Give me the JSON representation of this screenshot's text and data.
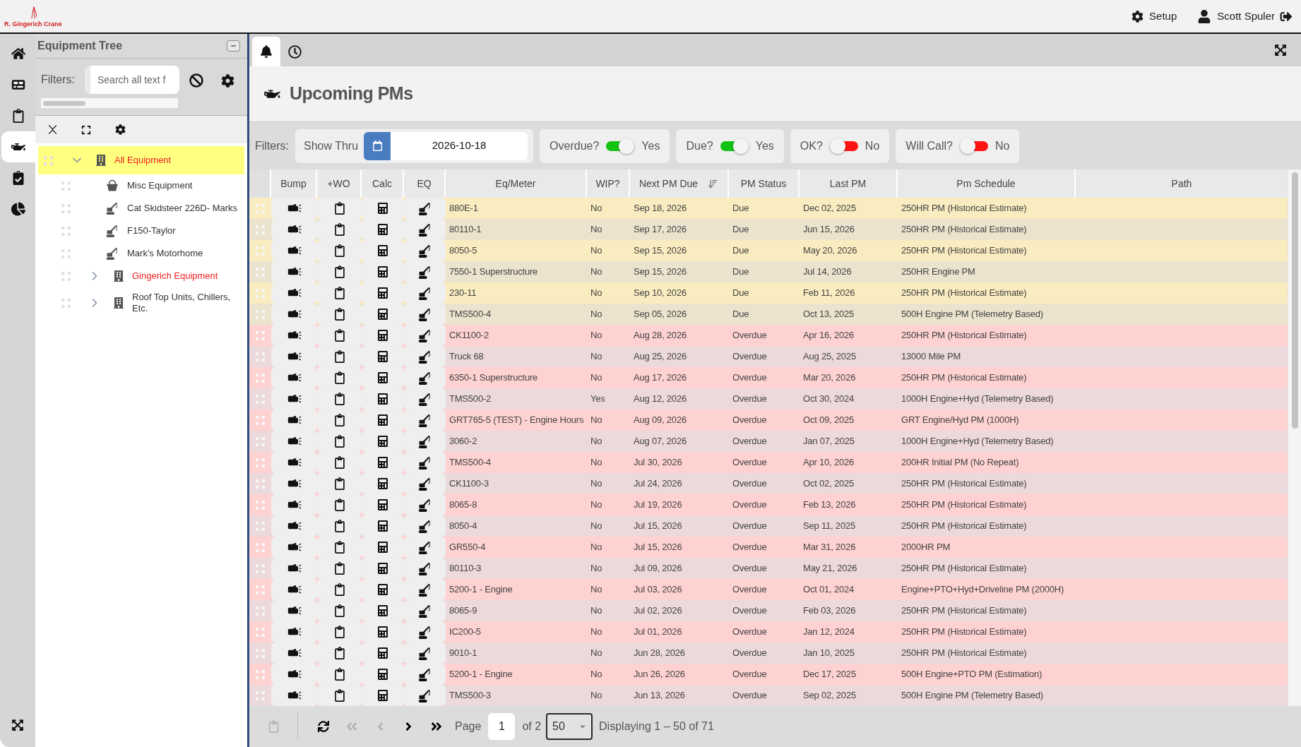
{
  "header": {
    "logo_text": "R. Gingerich Crane",
    "setup_label": "Setup",
    "user_name": "Scott Spuler"
  },
  "nav": [
    {
      "selected": false
    },
    {
      "selected": false
    },
    {
      "selected": false
    },
    {
      "selected": true
    },
    {
      "selected": false
    },
    {
      "selected": false
    }
  ],
  "tree": {
    "title": "Equipment Tree",
    "filters_label": "Filters:",
    "search": {
      "placeholder": "Search all text f"
    },
    "items": [
      {
        "label": "All Equipment",
        "kind": "group",
        "color": "#f21d1d",
        "selected": true,
        "expanded": true,
        "children": [
          {
            "label": "Misc Equipment",
            "kind": "bucket",
            "color": "#333333",
            "selected": false
          },
          {
            "label": "Cat Skidsteer 226D- Marks",
            "kind": "machine",
            "color": "#333333",
            "selected": false
          },
          {
            "label": "F150-Taylor",
            "kind": "machine",
            "color": "#333333",
            "selected": false
          },
          {
            "label": "Mark's Motorhome",
            "kind": "machine",
            "color": "#333333",
            "selected": false
          },
          {
            "label": "Gingerich Equipment",
            "kind": "group",
            "color": "#f21d1d",
            "selected": false,
            "expanded": false
          },
          {
            "label": "Roof Top Units, Chillers, Etc.",
            "kind": "group",
            "color": "#333333",
            "selected": false,
            "expanded": false
          }
        ]
      }
    ]
  },
  "tabs": [
    {
      "selected": true
    },
    {
      "selected": false
    }
  ],
  "page": {
    "title": "Upcoming PMs"
  },
  "filters": {
    "label": "Filters:",
    "show_thru": {
      "label": "Show Thru",
      "value": "2026-10-18"
    },
    "toggles": [
      {
        "label": "Overdue?",
        "on": true,
        "value_label": "Yes"
      },
      {
        "label": "Due?",
        "on": true,
        "value_label": "Yes"
      },
      {
        "label": "OK?",
        "on": false,
        "value_label": "No"
      },
      {
        "label": "Will Call?",
        "on": false,
        "value_label": "No"
      }
    ]
  },
  "table": {
    "columns": [
      {
        "label": "Bump",
        "sorted": false
      },
      {
        "label": "+WO",
        "sorted": false
      },
      {
        "label": "Calc",
        "sorted": false
      },
      {
        "label": "EQ",
        "sorted": false
      },
      {
        "label": "Eq/Meter",
        "sorted": false
      },
      {
        "label": "WIP?",
        "sorted": false
      },
      {
        "label": "Next PM Due",
        "sorted": true
      },
      {
        "label": "PM Status",
        "sorted": false
      },
      {
        "label": "Last PM",
        "sorted": false
      },
      {
        "label": "Pm Schedule",
        "sorted": false
      },
      {
        "label": "Path",
        "sorted": false
      }
    ],
    "rows": [
      {
        "kind": "due",
        "eq_meter": "880E-1",
        "wip": "No",
        "next_pm_due": "Sep 18, 2026",
        "pm_status": "Due",
        "last_pm": "Dec 02, 2025",
        "pm_schedule": "250HR PM (Historical Estimate)"
      },
      {
        "kind": "due",
        "eq_meter": "80110-1",
        "wip": "No",
        "next_pm_due": "Sep 17, 2026",
        "pm_status": "Due",
        "last_pm": "Jun 15, 2026",
        "pm_schedule": "250HR PM (Historical Estimate)"
      },
      {
        "kind": "due",
        "eq_meter": "8050-5",
        "wip": "No",
        "next_pm_due": "Sep 15, 2026",
        "pm_status": "Due",
        "last_pm": "May 20, 2026",
        "pm_schedule": "250HR PM (Historical Estimate)"
      },
      {
        "kind": "due",
        "eq_meter": "7550-1 Superstructure",
        "wip": "No",
        "next_pm_due": "Sep 15, 2026",
        "pm_status": "Due",
        "last_pm": "Jul 14, 2026",
        "pm_schedule": "250HR Engine PM"
      },
      {
        "kind": "due",
        "eq_meter": "230-11",
        "wip": "No",
        "next_pm_due": "Sep 10, 2026",
        "pm_status": "Due",
        "last_pm": "Feb 11, 2026",
        "pm_schedule": "250HR PM (Historical Estimate)"
      },
      {
        "kind": "due",
        "eq_meter": "TMS500-4",
        "wip": "No",
        "next_pm_due": "Sep 05, 2026",
        "pm_status": "Due",
        "last_pm": "Oct 13, 2025",
        "pm_schedule": "500H Engine PM (Telemetry Based)"
      },
      {
        "kind": "overdue",
        "eq_meter": "CK1100-2",
        "wip": "No",
        "next_pm_due": "Aug 28, 2026",
        "pm_status": "Overdue",
        "last_pm": "Apr 16, 2026",
        "pm_schedule": "250HR PM (Historical Estimate)"
      },
      {
        "kind": "overdue",
        "eq_meter": "Truck 68",
        "wip": "No",
        "next_pm_due": "Aug 25, 2026",
        "pm_status": "Overdue",
        "last_pm": "Aug 25, 2025",
        "pm_schedule": "13000 Mile PM"
      },
      {
        "kind": "overdue",
        "eq_meter": "6350-1 Superstructure",
        "wip": "No",
        "next_pm_due": "Aug 17, 2026",
        "pm_status": "Overdue",
        "last_pm": "Mar 20, 2026",
        "pm_schedule": "250HR PM (Historical Estimate)"
      },
      {
        "kind": "overdue",
        "eq_meter": "TMS500-2",
        "wip": "Yes",
        "next_pm_due": "Aug 12, 2026",
        "pm_status": "Overdue",
        "last_pm": "Oct 30, 2024",
        "pm_schedule": "1000H Engine+Hyd (Telemetry Based)"
      },
      {
        "kind": "overdue",
        "eq_meter": "GRT765-5 (TEST) - Engine Hours",
        "wip": "No",
        "next_pm_due": "Aug 09, 2026",
        "pm_status": "Overdue",
        "last_pm": "Oct 09, 2025",
        "pm_schedule": "GRT Engine/Hyd PM (1000H)"
      },
      {
        "kind": "overdue",
        "eq_meter": "3060-2",
        "wip": "No",
        "next_pm_due": "Aug 07, 2026",
        "pm_status": "Overdue",
        "last_pm": "Jan 07, 2025",
        "pm_schedule": "1000H Engine+Hyd (Telemetry Based)"
      },
      {
        "kind": "overdue",
        "eq_meter": "TMS500-4",
        "wip": "No",
        "next_pm_due": "Jul 30, 2026",
        "pm_status": "Overdue",
        "last_pm": "Apr 10, 2026",
        "pm_schedule": "200HR Initial PM (No Repeat)"
      },
      {
        "kind": "overdue",
        "eq_meter": "CK1100-3",
        "wip": "No",
        "next_pm_due": "Jul 24, 2026",
        "pm_status": "Overdue",
        "last_pm": "Oct 02, 2025",
        "pm_schedule": "250HR PM (Historical Estimate)"
      },
      {
        "kind": "overdue",
        "eq_meter": "8065-8",
        "wip": "No",
        "next_pm_due": "Jul 19, 2026",
        "pm_status": "Overdue",
        "last_pm": "Feb 13, 2026",
        "pm_schedule": "250HR PM (Historical Estimate)"
      },
      {
        "kind": "overdue",
        "eq_meter": "8050-4",
        "wip": "No",
        "next_pm_due": "Jul 15, 2026",
        "pm_status": "Overdue",
        "last_pm": "Sep 11, 2025",
        "pm_schedule": "250HR PM (Historical Estimate)"
      },
      {
        "kind": "overdue",
        "eq_meter": "GR550-4",
        "wip": "No",
        "next_pm_due": "Jul 15, 2026",
        "pm_status": "Overdue",
        "last_pm": "Mar 31, 2026",
        "pm_schedule": "2000HR PM"
      },
      {
        "kind": "overdue",
        "eq_meter": "80110-3",
        "wip": "No",
        "next_pm_due": "Jul 09, 2026",
        "pm_status": "Overdue",
        "last_pm": "May 21, 2026",
        "pm_schedule": "250HR PM (Historical Estimate)"
      },
      {
        "kind": "overdue",
        "eq_meter": "5200-1 - Engine",
        "wip": "No",
        "next_pm_due": "Jul 03, 2026",
        "pm_status": "Overdue",
        "last_pm": "Oct 01, 2024",
        "pm_schedule": "Engine+PTO+Hyd+Driveline PM (2000H)"
      },
      {
        "kind": "overdue",
        "eq_meter": "8065-9",
        "wip": "No",
        "next_pm_due": "Jul 02, 2026",
        "pm_status": "Overdue",
        "last_pm": "Feb 03, 2026",
        "pm_schedule": "250HR PM (Historical Estimate)"
      },
      {
        "kind": "overdue",
        "eq_meter": "IC200-5",
        "wip": "No",
        "next_pm_due": "Jul 01, 2026",
        "pm_status": "Overdue",
        "last_pm": "Jan 12, 2024",
        "pm_schedule": "250HR PM (Historical Estimate)"
      },
      {
        "kind": "overdue",
        "eq_meter": "9010-1",
        "wip": "No",
        "next_pm_due": "Jun 28, 2026",
        "pm_status": "Overdue",
        "last_pm": "Jan 10, 2025",
        "pm_schedule": "250HR PM (Historical Estimate)"
      },
      {
        "kind": "overdue",
        "eq_meter": "5200-1 - Engine",
        "wip": "No",
        "next_pm_due": "Jun 26, 2026",
        "pm_status": "Overdue",
        "last_pm": "Dec 17, 2025",
        "pm_schedule": "500H Engine+PTO PM (Estimation)"
      },
      {
        "kind": "overdue",
        "eq_meter": "TMS500-3",
        "wip": "No",
        "next_pm_due": "Jun 13, 2026",
        "pm_status": "Overdue",
        "last_pm": "Sep 02, 2025",
        "pm_schedule": "500H Engine PM (Telemetry Based)"
      }
    ]
  },
  "pager": {
    "buttons": [
      {
        "disabled": true
      },
      {
        "disabled": false
      },
      {
        "disabled": true
      },
      {
        "disabled": true
      },
      {
        "disabled": false
      },
      {
        "disabled": false
      }
    ],
    "page_label": "Page",
    "page": "1",
    "of_pages": "of 2",
    "page_size": "50",
    "summary": "Displaying 1 – 50 of 71"
  }
}
